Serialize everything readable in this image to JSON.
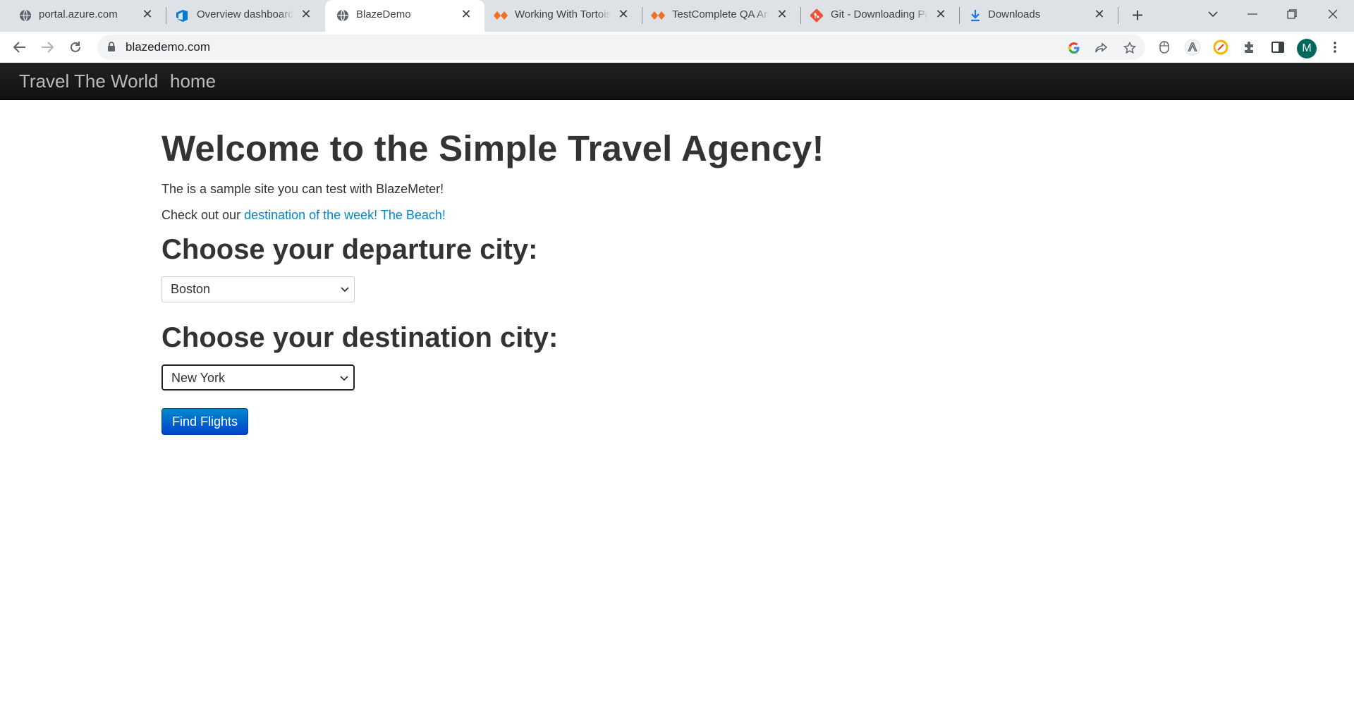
{
  "browser": {
    "tabs": [
      {
        "title": "portal.azure.com",
        "icon": "globe-icon"
      },
      {
        "title": "Overview dashboard - ",
        "icon": "azure-devops-icon"
      },
      {
        "title": "BlazeDemo",
        "icon": "globe-icon",
        "active": true
      },
      {
        "title": "Working With TortoiseGit",
        "icon": "testcomplete-icon"
      },
      {
        "title": "TestComplete QA Archive",
        "icon": "testcomplete-icon"
      },
      {
        "title": "Git - Downloading Package",
        "icon": "git-icon"
      },
      {
        "title": "Downloads",
        "icon": "download-icon"
      }
    ],
    "url": "blazedemo.com",
    "profile_initial": "M"
  },
  "navbar": {
    "brand": "Travel The World",
    "home_link": "home"
  },
  "main": {
    "title": "Welcome to the Simple Travel Agency!",
    "intro": "The is a sample site you can test with BlazeMeter!",
    "promo_prefix": "Check out our ",
    "promo_link": "destination of the week! The Beach!",
    "departure_heading": "Choose your departure city:",
    "departure_value": "Boston",
    "destination_heading": "Choose your destination city:",
    "destination_value": "New York",
    "find_button": "Find Flights"
  },
  "colors": {
    "navbar": "#1b1b1b",
    "link": "#0088cc",
    "button": "#0055cc",
    "avatar": "#00695c"
  }
}
